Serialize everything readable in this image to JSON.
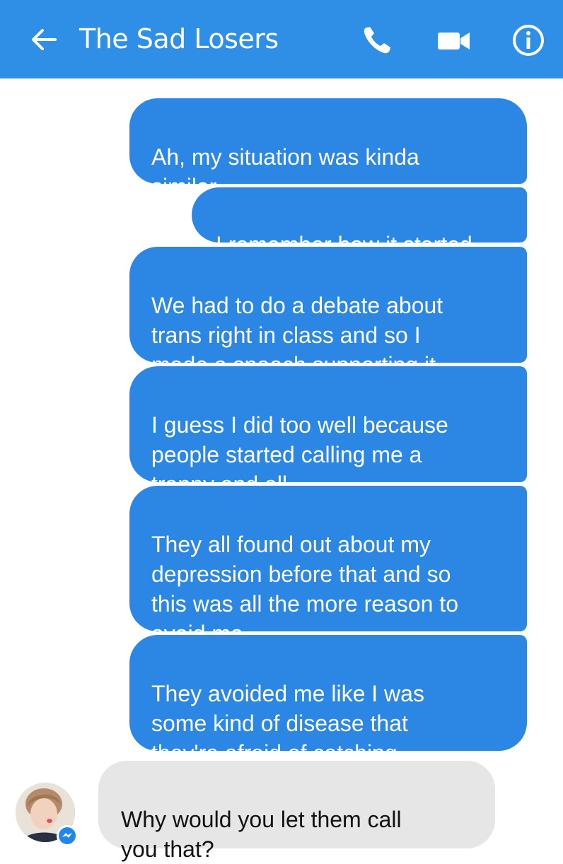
{
  "header": {
    "title": "The Sad Losers",
    "background_color": "#2f8fe6"
  },
  "icons": {
    "back": "arrow-left-icon",
    "call": "phone-icon",
    "video": "video-camera-icon",
    "info": "info-icon",
    "messenger_badge": "messenger-icon"
  },
  "messages": [
    {
      "sender": "me",
      "text": "Ah, my situation was kinda\nsimilar"
    },
    {
      "sender": "me",
      "text": "I remember how it started"
    },
    {
      "sender": "me",
      "text": "We had to do a debate about\ntrans right in class and so I\nmade a speech supporting it"
    },
    {
      "sender": "me",
      "text": "I guess I did too well because\npeople started calling me a\ntranny and all"
    },
    {
      "sender": "me",
      "text": "They all found out about my\ndepression before that and so\nthis was all the more reason to\navoid me"
    },
    {
      "sender": "me",
      "text": "They avoided me like I was\nsome kind of disease that\nthey're afraid of catching"
    },
    {
      "sender": "them",
      "text": "Why would you let them call\nyou that?"
    }
  ],
  "colors": {
    "outgoing_bubble": "#2b87e3",
    "incoming_bubble": "#e6e6e6"
  }
}
